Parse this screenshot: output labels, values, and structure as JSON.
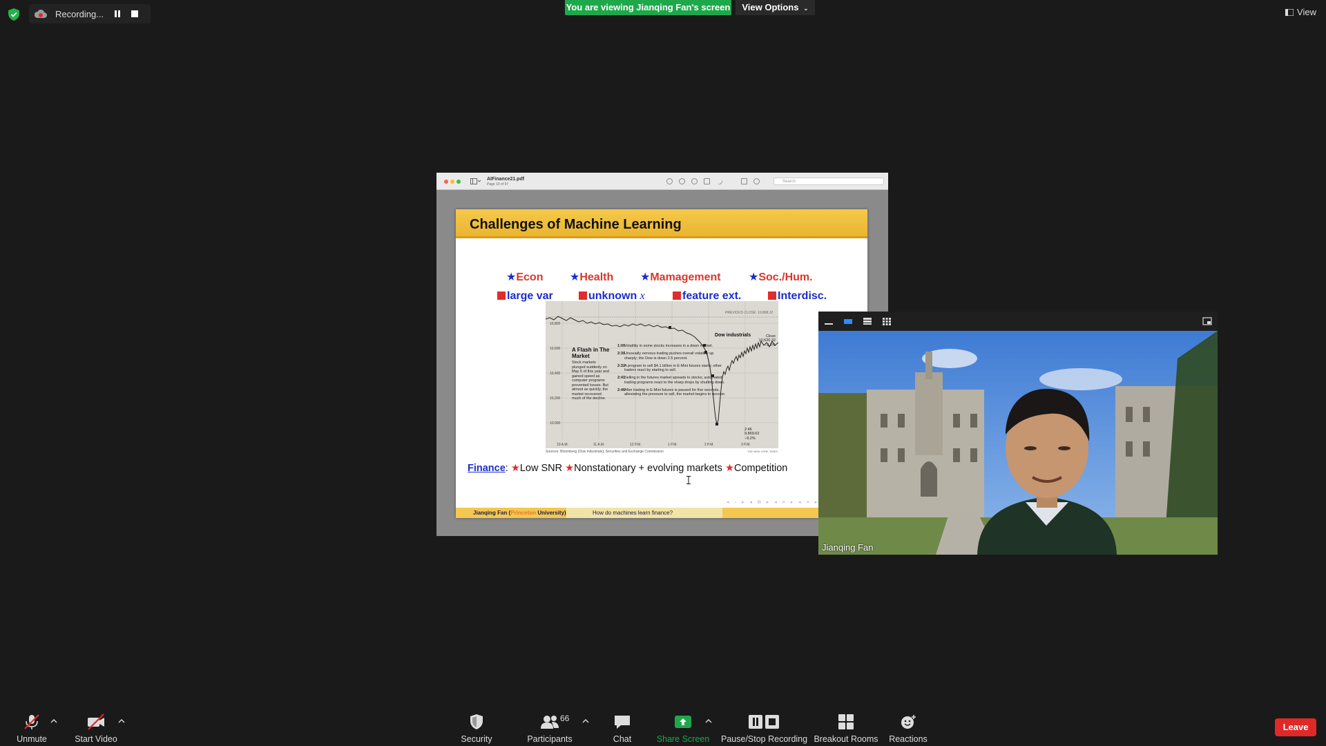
{
  "top": {
    "recording_label": "Recording...",
    "viewing_banner": "You are viewing Jianqing Fan's screen",
    "view_options": "View Options",
    "view_button": "View"
  },
  "pdf": {
    "filename": "AIFinance21.pdf",
    "page": "Page 10 of 97",
    "search_placeholder": "Search"
  },
  "slide": {
    "title": "Challenges of Machine Learning",
    "fields": [
      "Econ",
      "Health",
      "Mamagement",
      "Soc./Hum."
    ],
    "challenges": [
      "large var",
      "unknown ",
      "feature ext.",
      "Interdisc."
    ],
    "unknown_var": "x",
    "finance_label": "Finance",
    "finance_colon": ":",
    "finance_items": [
      "Low SNR",
      "Nonstationary",
      "+ evolving markets",
      "Competition"
    ],
    "footer_author": "Jianqing Fan (",
    "footer_univ": "Princeton",
    "footer_univ2": " University)",
    "footer_topic": "How do machines learn finance?",
    "nav_glyphs": "◂ ▫ ▸ ◂ ⧉ ▸ ◂ ≡ ▸ ◂ ≡ ▸ ◂ ▸ ↺"
  },
  "flash_graphic": {
    "heading": "A Flash in The Market",
    "description": "Stock markets plunged suddenly on May 6 of this year and gained speed as computer programs prevented losses. But almost as quickly, the market recovered much of the decline.",
    "prev_close": "PREVIOUS CLOSE: 10,868.12",
    "series_label": "Dow industrials",
    "close_text": "Close 10,520.32 −3.2%",
    "low_text": "2:46 9,869.62 −9.2%",
    "events": [
      {
        "time": "1:00",
        "text": "Volatility in some stocks increases in a down market."
      },
      {
        "time": "2:30",
        "text": "Unusually nervous trading pushes overall volatility up sharply; the Dow is down 2.5 percent."
      },
      {
        "time": "2:32",
        "text": "A program to sell $4.1 billion in E-Mini futures starts; other traders react by starting to sell."
      },
      {
        "time": "2:41",
        "text": "Selling in the futures market spreads to stocks; automated trading programs react to the sharp drops by shutting down."
      },
      {
        "time": "2:46",
        "text": "After trading in E-Mini futures is paused for five seconds, alleviating the pressure to sell, the market begins to recover."
      }
    ],
    "yticks": [
      "10,800",
      "10,600",
      "10,400",
      "10,200",
      "10,000"
    ],
    "xticks": [
      "10 A.M.",
      "11 A.M.",
      "12 P.M.",
      "1 P.M.",
      "2 P.M.",
      "3 P.M."
    ],
    "sources": "Sources: Bloomberg (Dow industrials); Securities and Exchange Commission",
    "credit": "THE NEW YORK TIMES"
  },
  "video": {
    "participant_name": "Jianqing Fan"
  },
  "toolbar": {
    "unmute": "Unmute",
    "start_video": "Start Video",
    "security": "Security",
    "participants": "Participants",
    "participant_count": "66",
    "chat": "Chat",
    "share_screen": "Share Screen",
    "pause_stop": "Pause/Stop Recording",
    "breakout": "Breakout Rooms",
    "reactions": "Reactions",
    "leave": "Leave"
  },
  "colors": {
    "banner_green": "#1ea84b",
    "leave_red": "#e02828",
    "slide_header_gold": "#f5c94a",
    "star_blue": "#1a2ccc",
    "field_red": "#d8372a"
  }
}
